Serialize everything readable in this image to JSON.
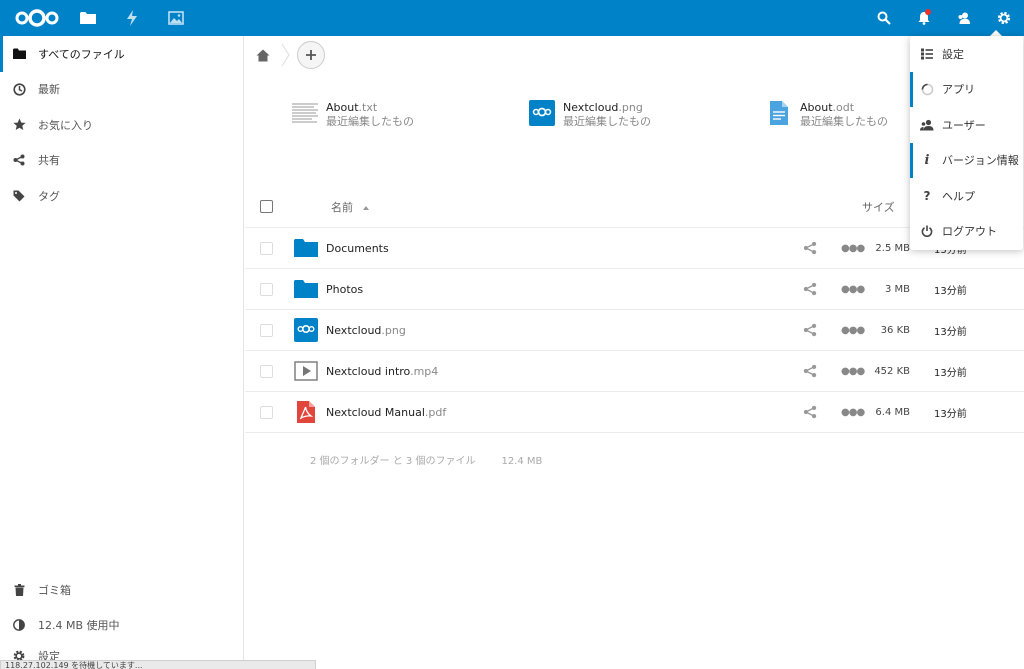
{
  "sidebar": {
    "items": [
      {
        "label": "すべてのファイル"
      },
      {
        "label": "最新"
      },
      {
        "label": "お気に入り"
      },
      {
        "label": "共有"
      },
      {
        "label": "タグ"
      }
    ],
    "bottom": [
      {
        "label": "ゴミ箱"
      },
      {
        "label": "12.4 MB 使用中"
      },
      {
        "label": "設定"
      }
    ]
  },
  "status_bar": {
    "text": "118.27.102.149 を待機しています..."
  },
  "recent": [
    {
      "name": "About",
      "ext": ".txt",
      "sub": "最近編集したもの"
    },
    {
      "name": "Nextcloud",
      "ext": ".png",
      "sub": "最近編集したもの"
    },
    {
      "name": "About",
      "ext": ".odt",
      "sub": "最近編集したもの"
    }
  ],
  "table": {
    "header": {
      "name": "名前",
      "size": "サイズ"
    },
    "rows": [
      {
        "name": "Documents",
        "ext": "",
        "size": "2.5 MB",
        "date": "13分前",
        "type": "folder"
      },
      {
        "name": "Photos",
        "ext": "",
        "size": "3 MB",
        "date": "13分前",
        "type": "folder"
      },
      {
        "name": "Nextcloud",
        "ext": ".png",
        "size": "36 KB",
        "date": "13分前",
        "type": "image"
      },
      {
        "name": "Nextcloud intro",
        "ext": ".mp4",
        "size": "452 KB",
        "date": "13分前",
        "type": "video"
      },
      {
        "name": "Nextcloud Manual",
        "ext": ".pdf",
        "size": "6.4 MB",
        "date": "13分前",
        "type": "pdf"
      }
    ],
    "summary": {
      "counts": "2 個のフォルダー と 3 個のファイル",
      "size": "12.4 MB"
    }
  },
  "menu": {
    "items": [
      {
        "label": "設定"
      },
      {
        "label": "アプリ"
      },
      {
        "label": "ユーザー"
      },
      {
        "label": "バージョン情報"
      },
      {
        "label": "ヘルプ"
      },
      {
        "label": "ログアウト"
      }
    ]
  },
  "colors": {
    "brand": "#0082c9",
    "pdf": "#e2453c"
  }
}
